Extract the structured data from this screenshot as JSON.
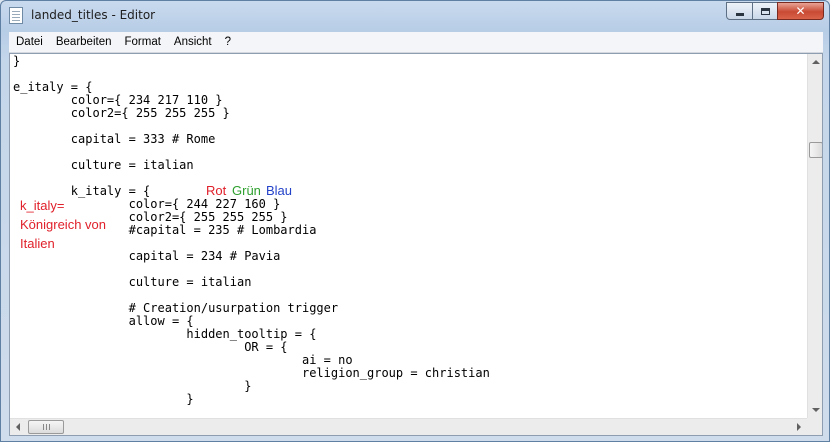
{
  "window": {
    "title": "landed_titles - Editor"
  },
  "menu": [
    "Datei",
    "Bearbeiten",
    "Format",
    "Ansicht",
    "?"
  ],
  "editor_lines": [
    "}",
    "",
    "e_italy = {",
    "\tcolor={ 234 217 110 }",
    "\tcolor2={ 255 255 255 }",
    "",
    "\tcapital = 333 # Rome",
    "",
    "\tculture = italian",
    "",
    "\tk_italy = {",
    "\t\tcolor={ 244 227 160 }",
    "\t\tcolor2={ 255 255 255 }",
    "\t\t#capital = 235 # Lombardia",
    "",
    "\t\tcapital = 234 # Pavia",
    "",
    "\t\tculture = italian",
    "",
    "\t\t# Creation/usurpation trigger",
    "\t\tallow = {",
    "\t\t\thidden_tooltip = {",
    "\t\t\t\tOR = {",
    "\t\t\t\t\tai = no",
    "\t\t\t\t\treligion_group = christian",
    "\t\t\t\t}",
    "\t\t\t}"
  ],
  "annotations": {
    "rot": "Rot",
    "gruen": "Grün",
    "blau": "Blau",
    "k_italy_note": [
      "k_italy=",
      "Königreich von",
      "Italien"
    ]
  },
  "colors": {
    "annotation_red": "#e0202a",
    "annotation_green": "#2ea02e",
    "annotation_blue": "#2342c8",
    "close_button": "#c94a34"
  },
  "icons": {
    "app": "notepad-icon",
    "minimize": "minimize-icon",
    "maximize": "maximize-icon",
    "close": "close-icon"
  }
}
